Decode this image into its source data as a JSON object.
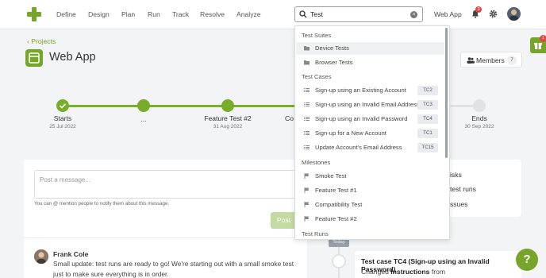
{
  "colors": {
    "accent": "#77a52a",
    "badge": "#e04848"
  },
  "nav": {
    "links": [
      "Define",
      "Design",
      "Plan",
      "Run",
      "Track",
      "Resolve",
      "Analyze"
    ],
    "search_value": "Test",
    "project_name": "Web App",
    "notification_count": "3"
  },
  "header": {
    "back_label": "Projects",
    "title": "Web App",
    "members_label": "Members",
    "members_count": "7",
    "side_badge_count": "1"
  },
  "milestones": [
    {
      "label": "Starts",
      "date": "25 Jul 2022"
    },
    {
      "label": "...",
      "date": ""
    },
    {
      "label": "Feature Test #2",
      "date": "31 Aug 2022"
    },
    {
      "label": "Co",
      "date": ""
    },
    {
      "label": "Ends",
      "date": "30 Sep 2022"
    }
  ],
  "message": {
    "placeholder": "Post a message...",
    "hint": "You can @ mention people to notify them about this message.",
    "post_label": "Post"
  },
  "post": {
    "author": "Frank Cole",
    "text": "Small update: test runs are ready to go! We're starting out with a small smoke test just to make sure everything is in order."
  },
  "right_panel": {
    "items": [
      "isks",
      "test runs",
      "ssues"
    ]
  },
  "activity": {
    "today_label": "Today",
    "title": "Test case TC4 (Sign-up using an Invalid Password)",
    "sub_prefix": "Changed",
    "sub_bold": "Instructions",
    "sub_suffix": "from"
  },
  "help_label": "?",
  "dropdown": {
    "sections": [
      {
        "title": "Test Suites",
        "items": [
          {
            "label": "Device Tests",
            "tag": "",
            "icon": "folder-icon",
            "selected": true
          },
          {
            "label": "Browser Tests",
            "tag": "",
            "icon": "folder-icon",
            "selected": false
          }
        ]
      },
      {
        "title": "Test Cases",
        "items": [
          {
            "label": "Sign-up using an Existing Account",
            "tag": "TC2",
            "icon": "list-icon"
          },
          {
            "label": "Sign-up using an Invalid Email Address",
            "tag": "TC3",
            "icon": "list-icon"
          },
          {
            "label": "Sign-up using an Invalid Password",
            "tag": "TC4",
            "icon": "list-icon"
          },
          {
            "label": "Sign-up for a New Account",
            "tag": "TC1",
            "icon": "list-icon"
          },
          {
            "label": "Update Account's Email Address",
            "tag": "TC15",
            "icon": "list-icon"
          }
        ]
      },
      {
        "title": "Milestones",
        "items": [
          {
            "label": "Smoke Test",
            "tag": "",
            "icon": "flag-icon"
          },
          {
            "label": "Feature Test #1",
            "tag": "",
            "icon": "flag-icon"
          },
          {
            "label": "Compatibility Test",
            "tag": "",
            "icon": "flag-icon"
          },
          {
            "label": "Feature Test #2",
            "tag": "",
            "icon": "flag-icon"
          }
        ]
      },
      {
        "title": "Test Runs",
        "items": []
      }
    ]
  }
}
